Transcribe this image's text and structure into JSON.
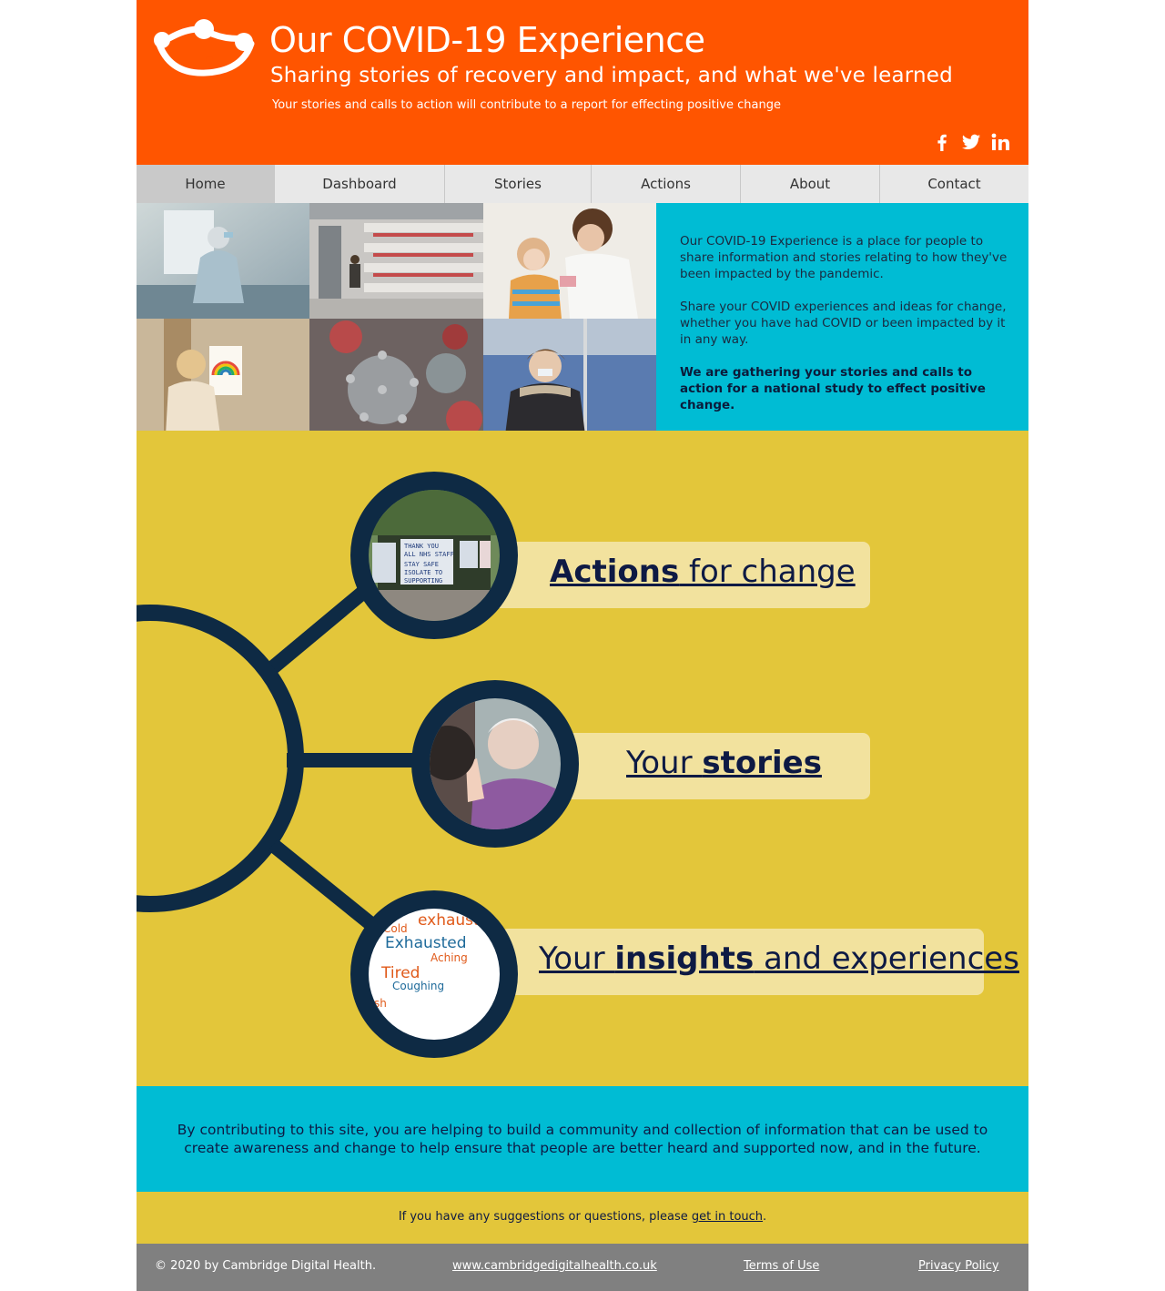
{
  "header": {
    "title": "Our COVID-19 Experience",
    "subtitle": "Sharing stories of recovery and impact, and what we've learned",
    "note": "Your stories and calls to action will contribute to a report for effecting positive change",
    "social_icons": [
      "facebook-icon",
      "twitter-icon",
      "linkedin-icon"
    ]
  },
  "nav": {
    "items": [
      "Home",
      "Dashboard",
      "Stories",
      "Actions",
      "About",
      "Contact"
    ],
    "active": "Home"
  },
  "intro": {
    "p1": "Our COVID-19 Experience is a place for people to share information and stories relating to how they've been impacted by the pandemic.",
    "p2": "Share your COVID experiences and ideas for change, whether you have had COVID or been impacted by it in any way.",
    "p3": "We are gathering your stories and calls to action for a national study to effect positive change."
  },
  "links": {
    "actions": {
      "bold": "Actions",
      "rest": " for change"
    },
    "stories": {
      "pre": "Your ",
      "bold": "stories"
    },
    "insights": {
      "pre": "Your ",
      "bold": "insights",
      "rest": " and experiences"
    }
  },
  "wordcloud": [
    "exhaust",
    "Cold",
    "Exhausted",
    "Aching",
    "Tired",
    "Coughing",
    "sh"
  ],
  "sign": [
    "THANK YOU",
    "ALL NHS STAFF",
    "STAY SAFE",
    "ISOLATE TO",
    "SUPPORTING"
  ],
  "band": {
    "text": "By contributing to this site, you are helping to build a community and collection of information that can be used to create awareness and change to help ensure that people are better heard and supported now, and in the future."
  },
  "strip": {
    "text": "If you have any suggestions or questions, please ",
    "link": "get in touch",
    "end": "."
  },
  "footer": {
    "copyright": "© 2020 by Cambridge Digital Health.",
    "website": "www.cambridgedigitalhealth.co.uk",
    "terms": "Terms of Use",
    "privacy": "Privacy Policy"
  },
  "colors": {
    "header": "#ff5500",
    "nav": "#e8e8e8",
    "teal": "#00bcd4",
    "yellow": "#e3c63a",
    "navy": "#0e2a44",
    "pill": "#f2e29e",
    "footer": "#808080"
  }
}
